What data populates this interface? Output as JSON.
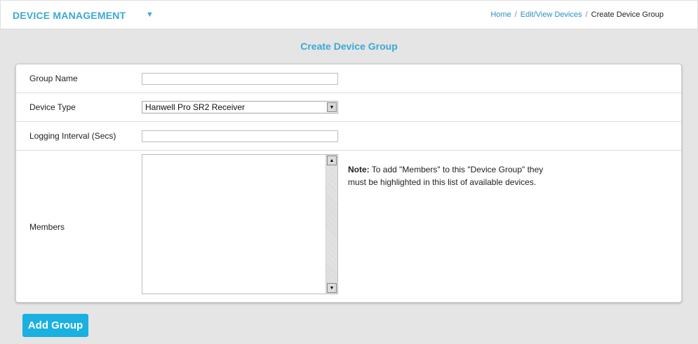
{
  "header": {
    "app_title": "DEVICE MANAGEMENT",
    "menu_arrow": "▼",
    "breadcrumb": {
      "home": "Home",
      "edit_view": "Edit/View Devices",
      "current": "Create Device Group",
      "separator": "/"
    }
  },
  "page": {
    "title": "Create Device Group"
  },
  "form": {
    "group_name": {
      "label": "Group Name",
      "value": ""
    },
    "device_type": {
      "label": "Device Type",
      "selected": "Hanwell Pro SR2 Receiver"
    },
    "logging_interval": {
      "label": "Logging Interval (Secs)",
      "value": ""
    },
    "members": {
      "label": "Members",
      "note_prefix": "Note:",
      "note_text": " To add \"Members\" to this \"Device Group\" they must be highlighted in this list of available devices."
    }
  },
  "actions": {
    "add_group": "Add Group"
  },
  "icons": {
    "dropdown": "▼",
    "scroll_up": "▲",
    "scroll_down": "▼"
  },
  "colors": {
    "accent": "#3aa9d2",
    "button": "#1ab0e0",
    "link": "#2a8fc4"
  }
}
